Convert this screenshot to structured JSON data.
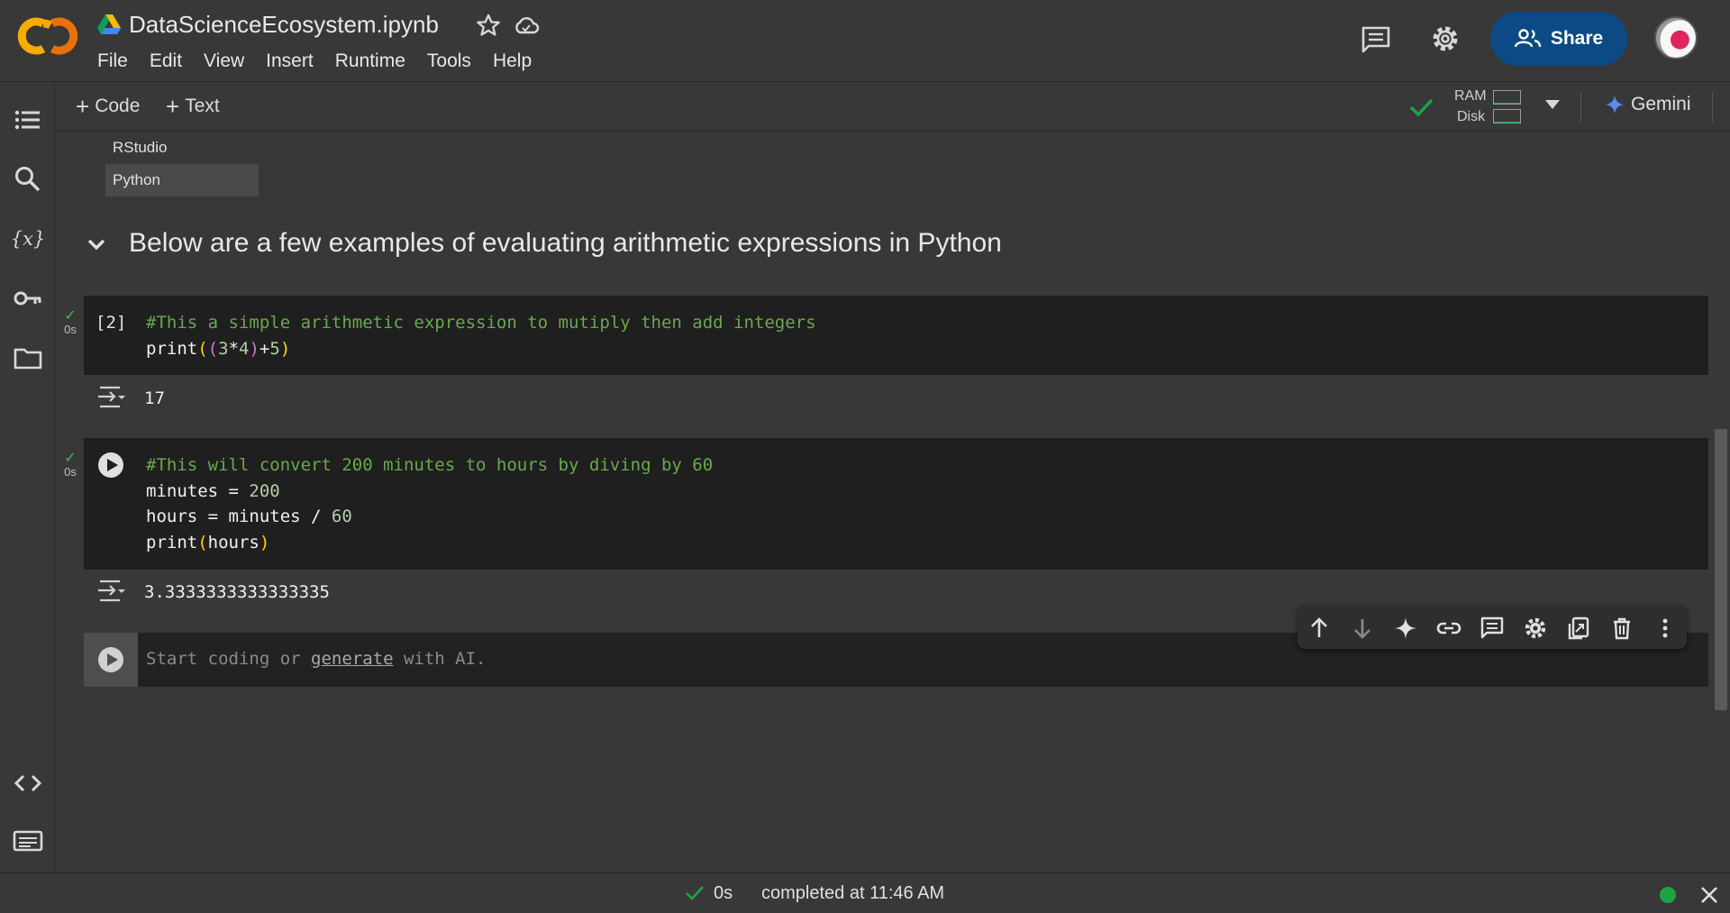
{
  "header": {
    "app_logo_text": "CO",
    "doc_title": "DataScienceEcosystem.ipynb",
    "menu": [
      "File",
      "Edit",
      "View",
      "Insert",
      "Runtime",
      "Tools",
      "Help"
    ],
    "share_label": "Share"
  },
  "toolbar": {
    "add_code_label": "Code",
    "add_text_label": "Text",
    "ram_label": "RAM",
    "disk_label": "Disk",
    "ram_usage_fraction": 0.05,
    "disk_usage_fraction": 0.06,
    "gemini_label": "Gemini"
  },
  "sidebar": {
    "icons": [
      "table-of-contents-icon",
      "search-icon",
      "variables-icon",
      "secrets-key-icon",
      "folder-icon",
      "code-snippets-icon",
      "terminal-icon"
    ]
  },
  "toc_items": [
    {
      "label": "RStudio",
      "selected": false
    },
    {
      "label": "Python",
      "selected": true
    }
  ],
  "section": {
    "heading": "Below are a few examples of evaluating arithmetic expressions in Python"
  },
  "cells": [
    {
      "exec_count": "[2]",
      "status_time": "0s",
      "code": [
        "#This a simple arithmetic expression to mutiply then add integers",
        "print((3*4)+5)"
      ],
      "output": "17"
    },
    {
      "exec_count": "",
      "status_time": "0s",
      "code": [
        "#This will convert 200 minutes to hours by diving by 60",
        "minutes = 200",
        "hours = minutes / 60",
        "print(hours)"
      ],
      "output": "3.3333333333333335"
    }
  ],
  "empty_cell": {
    "placeholder_start": "Start coding or ",
    "placeholder_link": "generate",
    "placeholder_end": " with AI."
  },
  "cell_toolbar": [
    "move-up-icon",
    "move-down-icon",
    "gemini-sparkle-icon",
    "link-icon",
    "comment-icon",
    "cell-settings-icon",
    "mirror-cell-icon",
    "delete-icon",
    "more-options-icon"
  ],
  "statusbar": {
    "elapsed": "0s",
    "message": "completed at 11:46 AM"
  },
  "colors": {
    "accent_blue": "#0b4a84",
    "success_green": "#1ea446",
    "background": "#383838",
    "cell_background": "#1f1f1f"
  }
}
